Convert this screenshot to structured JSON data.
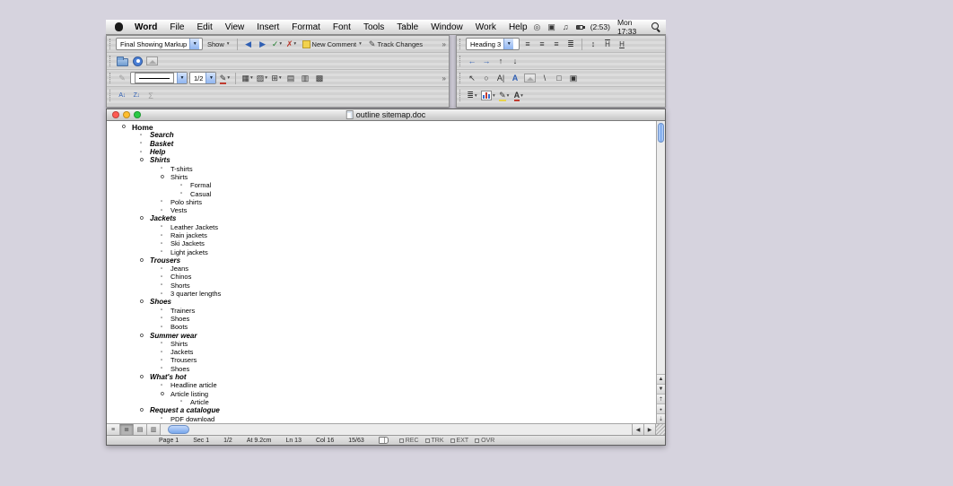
{
  "colors": {
    "aqua_thumb": "#78a7ec",
    "traffic_red": "#ff5a52",
    "traffic_yellow": "#ffbe2e",
    "traffic_green": "#2aca44",
    "comment_yellow": "#f2d24d",
    "accept_green": "#1e7d2c",
    "reject_red": "#b8362a"
  },
  "menubar": {
    "app": "Word",
    "menus": [
      "File",
      "Edit",
      "View",
      "Insert",
      "Format",
      "Font",
      "Tools",
      "Table",
      "Window",
      "Work",
      "Help"
    ],
    "battery": "(2:53)",
    "clock": "Mon 17:33"
  },
  "toolbars": {
    "reviewing": {
      "display_for_review": "Final Showing Markup",
      "show": "Show",
      "new_comment": "New Comment",
      "track_changes": "Track Changes"
    },
    "formatting": {
      "style": "Heading 3"
    },
    "border": {
      "line_weight": "1/2"
    }
  },
  "window": {
    "title": "outline sitemap.doc"
  },
  "document": {
    "outline": [
      {
        "level": 1,
        "marker": "expand",
        "style": "h1",
        "text": "Home"
      },
      {
        "level": 2,
        "marker": "leaf",
        "style": "h2",
        "text": "Search"
      },
      {
        "level": 2,
        "marker": "leaf",
        "style": "h2",
        "text": "Basket"
      },
      {
        "level": 2,
        "marker": "leaf",
        "style": "h2",
        "text": "Help"
      },
      {
        "level": 2,
        "marker": "expand",
        "style": "h2",
        "text": "Shirts"
      },
      {
        "level": 3,
        "marker": "leaf",
        "style": "body",
        "text": "T-shirts"
      },
      {
        "level": 3,
        "marker": "expand",
        "style": "body",
        "text": "Shirts"
      },
      {
        "level": 4,
        "marker": "leaf",
        "style": "body",
        "text": "Formal"
      },
      {
        "level": 4,
        "marker": "leaf",
        "style": "body",
        "text": "Casual"
      },
      {
        "level": 3,
        "marker": "leaf",
        "style": "body",
        "text": "Polo shirts"
      },
      {
        "level": 3,
        "marker": "leaf",
        "style": "body",
        "text": "Vests"
      },
      {
        "level": 2,
        "marker": "expand",
        "style": "h2",
        "text": "Jackets"
      },
      {
        "level": 3,
        "marker": "leaf",
        "style": "body",
        "text": "Leather Jackets"
      },
      {
        "level": 3,
        "marker": "leaf",
        "style": "body",
        "text": "Rain jackets"
      },
      {
        "level": 3,
        "marker": "leaf",
        "style": "body",
        "text": "Ski Jackets"
      },
      {
        "level": 3,
        "marker": "leaf",
        "style": "body",
        "text": "Light jackets"
      },
      {
        "level": 2,
        "marker": "expand",
        "style": "h2",
        "text": "Trousers"
      },
      {
        "level": 3,
        "marker": "leaf",
        "style": "body",
        "text": "Jeans"
      },
      {
        "level": 3,
        "marker": "leaf",
        "style": "body",
        "text": "Chinos"
      },
      {
        "level": 3,
        "marker": "leaf",
        "style": "body",
        "text": "Shorts"
      },
      {
        "level": 3,
        "marker": "leaf",
        "style": "body",
        "text": "3 quarter lengths"
      },
      {
        "level": 2,
        "marker": "expand",
        "style": "h2",
        "text": "Shoes"
      },
      {
        "level": 3,
        "marker": "leaf",
        "style": "body",
        "text": "Trainers"
      },
      {
        "level": 3,
        "marker": "leaf",
        "style": "body",
        "text": "Shoes"
      },
      {
        "level": 3,
        "marker": "leaf",
        "style": "body",
        "text": "Boots"
      },
      {
        "level": 2,
        "marker": "expand",
        "style": "h2",
        "text": "Summer wear"
      },
      {
        "level": 3,
        "marker": "leaf",
        "style": "body",
        "text": "Shirts"
      },
      {
        "level": 3,
        "marker": "leaf",
        "style": "body",
        "text": "Jackets"
      },
      {
        "level": 3,
        "marker": "leaf",
        "style": "body",
        "text": "Trousers"
      },
      {
        "level": 3,
        "marker": "leaf",
        "style": "body",
        "text": "Shoes"
      },
      {
        "level": 2,
        "marker": "expand",
        "style": "h2",
        "text": "What's hot"
      },
      {
        "level": 3,
        "marker": "leaf",
        "style": "body",
        "text": "Headline article"
      },
      {
        "level": 3,
        "marker": "expand",
        "style": "body",
        "text": "Article listing"
      },
      {
        "level": 4,
        "marker": "leaf",
        "style": "body",
        "text": "Article"
      },
      {
        "level": 2,
        "marker": "expand",
        "style": "h2",
        "text": "Request a catalogue"
      },
      {
        "level": 3,
        "marker": "leaf",
        "style": "body",
        "text": "PDF download"
      }
    ]
  },
  "statusbar": {
    "fields": [
      "Page 1",
      "Sec 1",
      "1/2",
      "At 9.2cm",
      "Ln 13",
      "Col 16",
      "15/63"
    ],
    "indicators": [
      "REC",
      "TRK",
      "EXT",
      "OVR"
    ]
  }
}
